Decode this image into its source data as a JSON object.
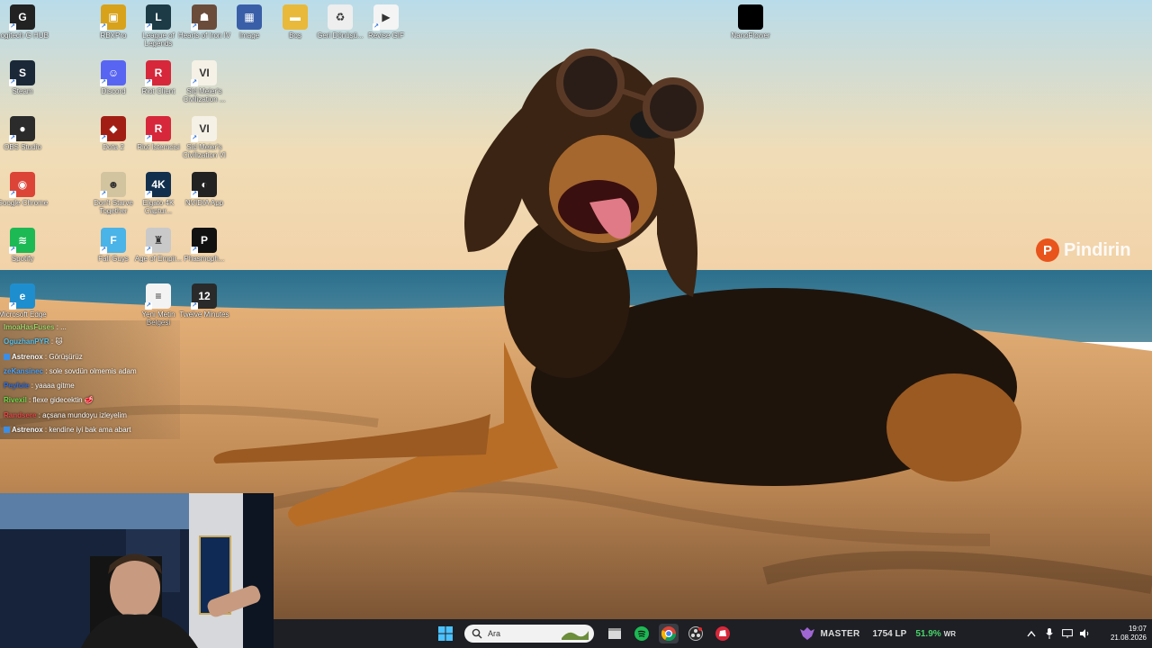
{
  "desktop_icons": [
    {
      "name": "logitech-ghub",
      "label": "Logitech G HUB",
      "color": "#222222",
      "glyph": "G"
    },
    {
      "name": "steam",
      "label": "Steam",
      "color": "#1b2838",
      "glyph": "S"
    },
    {
      "name": "obs-studio",
      "label": "OBS Studio",
      "color": "#2b2b2b",
      "glyph": "●"
    },
    {
      "name": "google-chrome",
      "label": "Google Chrome",
      "color": "#db4437",
      "glyph": "◉"
    },
    {
      "name": "spotify",
      "label": "Spotify",
      "color": "#1db954",
      "glyph": "≋"
    },
    {
      "name": "microsoft-edge",
      "label": "Microsoft Edge",
      "color": "#1f8ecf",
      "glyph": "e"
    },
    {
      "name": "rbxpro",
      "label": "RBXPro",
      "color": "#d8a21a",
      "glyph": "▣"
    },
    {
      "name": "discord",
      "label": "Discord",
      "color": "#5865f2",
      "glyph": "☺"
    },
    {
      "name": "dota2",
      "label": "Dota 2",
      "color": "#a21e15",
      "glyph": "◆"
    },
    {
      "name": "dont-starve",
      "label": "Don't Starve Together",
      "color": "#d2c49e",
      "glyph": "☻"
    },
    {
      "name": "fall-guys",
      "label": "Fall Guys",
      "color": "#4ab3e8",
      "glyph": "F"
    },
    {
      "name": "league",
      "label": "League of Legends",
      "color": "#1c3b47",
      "glyph": "L"
    },
    {
      "name": "riot-client",
      "label": "Riot Client",
      "color": "#d6283a",
      "glyph": "R"
    },
    {
      "name": "riot-installer",
      "label": "Riot İstemcisi",
      "color": "#d6283a",
      "glyph": "R"
    },
    {
      "name": "elgato",
      "label": "Elgato 4K Captur...",
      "color": "#12304e",
      "glyph": "4K"
    },
    {
      "name": "aoe",
      "label": "Age of Empir...",
      "color": "#c9c9c9",
      "glyph": "♜"
    },
    {
      "name": "yeni-metin",
      "label": "Yeni Metin Belgesi",
      "color": "#f3f3f3",
      "glyph": "≡"
    },
    {
      "name": "hoi4",
      "label": "Hearts of Iron IV",
      "color": "#6b4c3a",
      "glyph": "☗"
    },
    {
      "name": "civ6-a",
      "label": "Sid Meier's Civilization ...",
      "color": "#f5f1e6",
      "glyph": "VI"
    },
    {
      "name": "civ6-b",
      "label": "Sid Meier's Civilization VI",
      "color": "#f5f1e6",
      "glyph": "VI"
    },
    {
      "name": "nvidia-app",
      "label": "NVIDIA App",
      "color": "#222222",
      "glyph": "◐"
    },
    {
      "name": "phasmophobia",
      "label": "Phasmoph...",
      "color": "#111111",
      "glyph": "P"
    },
    {
      "name": "twelve-minutes",
      "label": "Twelve Minutes",
      "color": "#2a2a2a",
      "glyph": "12"
    },
    {
      "name": "image",
      "label": "Image",
      "color": "#3a5fa8",
      "glyph": "▦"
    },
    {
      "name": "bos",
      "label": "Boş",
      "color": "#e8b93a",
      "glyph": "▬"
    },
    {
      "name": "geri-donusum",
      "label": "Geri Dönüşü...",
      "color": "#eeeeee",
      "glyph": "♻"
    },
    {
      "name": "revise-gif",
      "label": "Revise GIF",
      "color": "#f4f4f4",
      "glyph": "▶"
    },
    {
      "name": "nanoflower",
      "label": "NanoFlower",
      "color": "#000000",
      "glyph": ""
    }
  ],
  "chat": [
    {
      "user": "ImoaHasFuses",
      "msg": "...",
      "color": "#9fd56a",
      "badge": false
    },
    {
      "user": "OguzhanPYR",
      "msg": "🐱",
      "color": "#58c3f0",
      "badge": false
    },
    {
      "user": "Astrenox",
      "msg": "Görüşürüz",
      "color": "#ffffff",
      "badge": true
    },
    {
      "user": "zeKansinec",
      "msg": "sole sovdün olmemis adam",
      "color": "#4aa3ff",
      "badge": false
    },
    {
      "user": "Peyfole",
      "msg": "yaaaa gitme",
      "color": "#2f6fe0",
      "badge": false
    },
    {
      "user": "Rivexil",
      "msg": "flexe gidecektin 🥩",
      "color": "#6ddb4a",
      "badge": false
    },
    {
      "user": "Randsere",
      "msg": "açsana mundoyu izleyelim",
      "color": "#e24848",
      "badge": false
    },
    {
      "user": "Astrenox",
      "msg": "kendine iyi bak ama abart",
      "color": "#ffffff",
      "badge": true
    }
  ],
  "taskbar": {
    "search_placeholder": "Ara",
    "apps": [
      "file-explorer-icon",
      "spotify-icon",
      "chrome-icon",
      "obs-icon",
      "riot-client-icon"
    ]
  },
  "rank": {
    "tier": "MASTER",
    "lp": "1754 LP",
    "winrate": "51.9%",
    "wr_label": "WR"
  },
  "clock": {
    "time": "19:07",
    "date": "21.08.2026"
  },
  "brand": {
    "text": "Pindirin",
    "accent": "#e8541c"
  }
}
